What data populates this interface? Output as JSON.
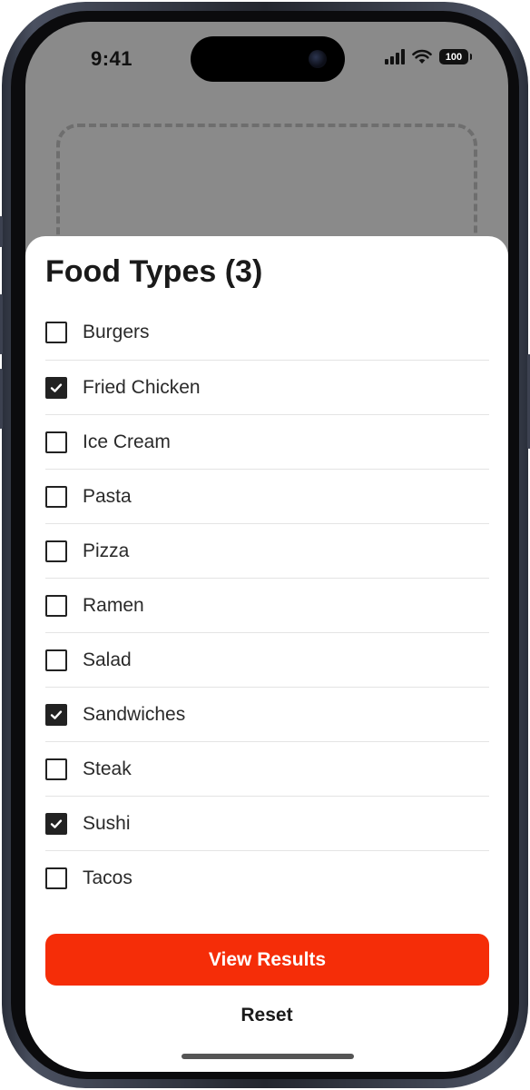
{
  "status_bar": {
    "time": "9:41",
    "battery": "100",
    "icons": [
      "signal-icon",
      "wifi-icon",
      "battery-icon"
    ]
  },
  "sheet": {
    "title": "Food Types (3)",
    "options": [
      {
        "label": "Burgers",
        "checked": false
      },
      {
        "label": "Fried Chicken",
        "checked": true
      },
      {
        "label": "Ice Cream",
        "checked": false
      },
      {
        "label": "Pasta",
        "checked": false
      },
      {
        "label": "Pizza",
        "checked": false
      },
      {
        "label": "Ramen",
        "checked": false
      },
      {
        "label": "Salad",
        "checked": false
      },
      {
        "label": "Sandwiches",
        "checked": true
      },
      {
        "label": "Steak",
        "checked": false
      },
      {
        "label": "Sushi",
        "checked": true
      },
      {
        "label": "Tacos",
        "checked": false
      }
    ],
    "primary_button": "View Results",
    "secondary_button": "Reset"
  },
  "colors": {
    "accent": "#f52d08",
    "checkbox": "#222222",
    "backdrop": "#8a8a8a"
  }
}
